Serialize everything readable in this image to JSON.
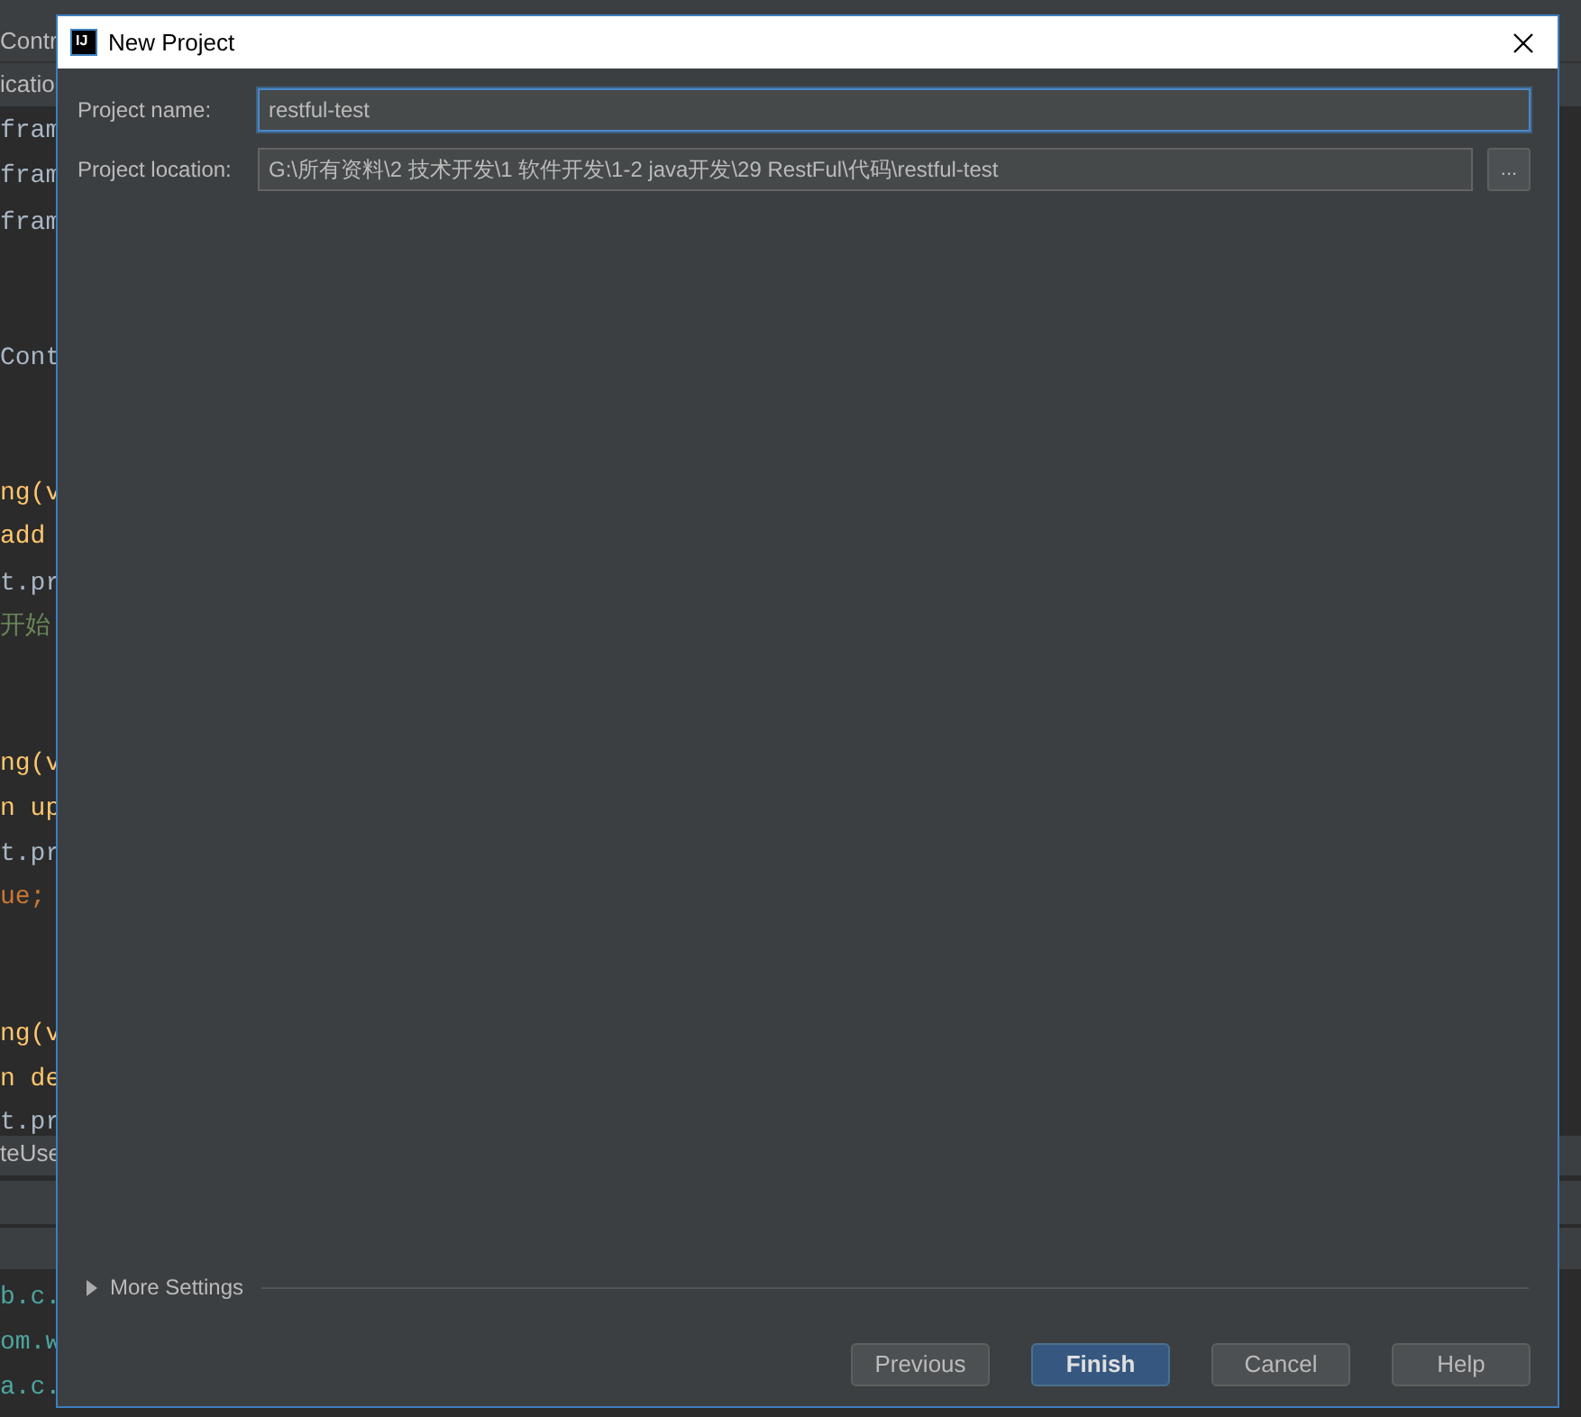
{
  "background_editor": {
    "lines": [
      {
        "text": "Contr",
        "color": "#bbbbbb"
      },
      {
        "text": "icatio",
        "color": "#bbbbbb"
      },
      {
        "text": "fram",
        "color": "#a9b7c6"
      },
      {
        "text": "fram",
        "color": "#a9b7c6"
      },
      {
        "text": "fram",
        "color": "#a9b7c6"
      },
      {
        "text": "Cont",
        "color": "#a9b7c6"
      },
      {
        "text": "ng(v",
        "color": "#ffc66d"
      },
      {
        "text": "add",
        "color": "#ffc66d"
      },
      {
        "text": "t.pr",
        "color": "#a9b7c6"
      },
      {
        "text": "开始",
        "color": "#6a8759"
      },
      {
        "text": "ng(v",
        "color": "#ffc66d"
      },
      {
        "text": "n up",
        "color": "#ffc66d"
      },
      {
        "text": "t.pr",
        "color": "#a9b7c6"
      },
      {
        "text": "ue;",
        "color": "#cc7832"
      },
      {
        "text": "ng(v",
        "color": "#ffc66d"
      },
      {
        "text": "n de",
        "color": "#ffc66d"
      },
      {
        "text": "t.pr",
        "color": "#a9b7c6"
      },
      {
        "text": "teUse",
        "color": "#bbbbbb"
      },
      {
        "text": "b.c.",
        "color": "#4ea6a0"
      },
      {
        "text": "om.w",
        "color": "#4ea6a0"
      },
      {
        "text": "a.c.",
        "color": "#4ea6a0"
      }
    ]
  },
  "window": {
    "title": "New Project",
    "logo": "IJ"
  },
  "fields": [
    {
      "label": "Project name:",
      "value": "restful-test",
      "focused": true
    },
    {
      "label": "Project location:",
      "value": "G:\\所有资料\\2 技术开发\\1 软件开发\\1-2 java开发\\29 RestFul\\代码\\restful-test",
      "browse": "..."
    }
  ],
  "more_settings": {
    "label": "More Settings",
    "expanded": false
  },
  "buttons": [
    {
      "label": "Previous",
      "default": false
    },
    {
      "label": "Finish",
      "default": true
    },
    {
      "label": "Cancel",
      "default": false
    },
    {
      "label": "Help",
      "default": false
    }
  ]
}
